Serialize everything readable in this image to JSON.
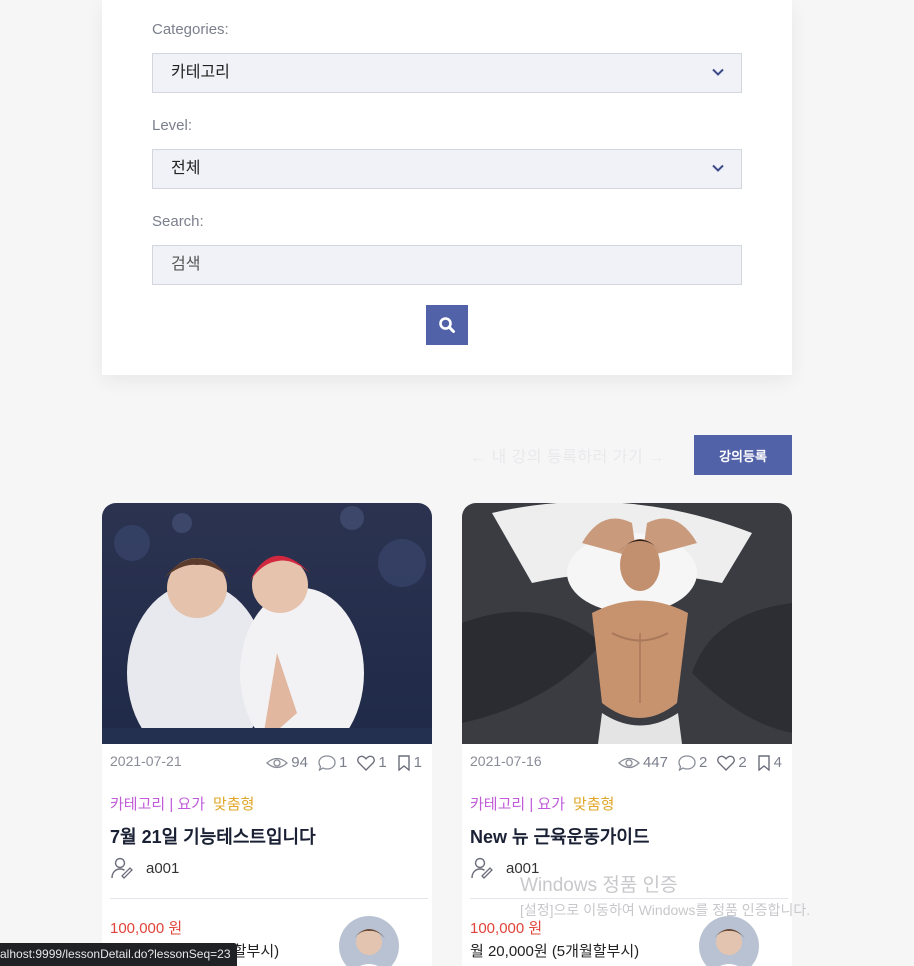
{
  "filter": {
    "categories_label": "Categories:",
    "categories_value": "카테고리",
    "level_label": "Level:",
    "level_value": "전체",
    "search_label": "Search:",
    "search_placeholder": "검색"
  },
  "register": {
    "hint": "← 내 강의 등록하러 가기 →",
    "button": "강의등록"
  },
  "cards": [
    {
      "date": "2021-07-21",
      "views": "94",
      "comments": "1",
      "likes": "1",
      "bookmarks": "1",
      "category": "카테고리 | 요가",
      "type": "맞춤형",
      "title": "7월 21일 기능테스트입니다",
      "author": "a001",
      "price": "100,000 원",
      "monthly": "월 20,000원 (5개월할부시)"
    },
    {
      "date": "2021-07-16",
      "views": "447",
      "comments": "2",
      "likes": "2",
      "bookmarks": "4",
      "category": "카테고리 | 요가",
      "type": "맞춤형",
      "title": "New 뉴 근육운동가이드",
      "author": "a001",
      "price": "100,000 원",
      "monthly": "월 20,000원 (5개월할부시)"
    }
  ],
  "windows_watermark": {
    "title": "Windows 정품 인증",
    "subtitle": "[설정]으로 이동하여 Windows를 정품 인증합니다."
  },
  "statusbar": {
    "url": "alhost:9999/lessonDetail.do?lessonSeq=23"
  },
  "colors": {
    "accent": "#5262a8",
    "category": "#c25bd9",
    "type": "#e0a72a",
    "price": "#e0443a"
  }
}
